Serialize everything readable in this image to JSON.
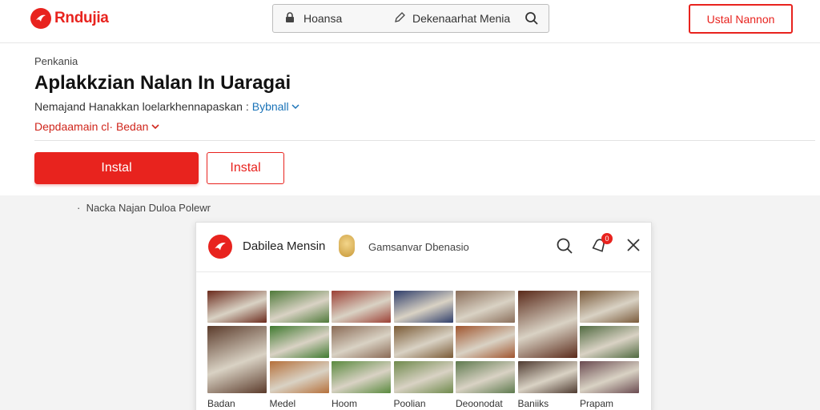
{
  "topbar": {
    "brand": "Rndujia",
    "search": {
      "left_label": "Hoansa",
      "placeholder": "Dekenaarhat Menia"
    },
    "install_button": "Ustal Nannon"
  },
  "main": {
    "breadcrumb": "Penkania",
    "title": "Aplakkzian Nalan In Uaragai",
    "meta_text": "Nemajand Hanakkan loelarkhennapaskan :",
    "meta_link": "Bybnall",
    "red_link": "Depdaamain cl· Bedan",
    "primary_button": "Instal",
    "secondary_button": "Instal"
  },
  "note": "Nacka Najan Duloa Polewr",
  "panel": {
    "title": "Dabilea Mensin",
    "subtitle": "Gamsanvar Dbenasio",
    "badge": "0",
    "gallery": [
      {
        "label": "Badan",
        "tiles": [
          {
            "color": "#6b2a1c",
            "size": "small"
          },
          {
            "color": "#5b3b2b",
            "size": "tall"
          }
        ]
      },
      {
        "label": "Medel",
        "tiles": [
          {
            "color": "#4f7a3a",
            "size": "small"
          },
          {
            "color": "#3f7a2f",
            "size": "small"
          },
          {
            "color": "#b5703a",
            "size": "small"
          }
        ]
      },
      {
        "label": "Hoom",
        "tiles": [
          {
            "color": "#9c4035",
            "size": "small"
          },
          {
            "color": "#8a6a55",
            "size": "small"
          },
          {
            "color": "#5a8a3e",
            "size": "small"
          }
        ]
      },
      {
        "label": "Poolian",
        "tiles": [
          {
            "color": "#2f3e6b",
            "size": "small"
          },
          {
            "color": "#7a5a35",
            "size": "small"
          },
          {
            "color": "#6f8a4c",
            "size": "small"
          }
        ]
      },
      {
        "label": "Deoonodat",
        "tiles": [
          {
            "color": "#8a6e5a",
            "size": "small"
          },
          {
            "color": "#a0552e",
            "size": "small"
          },
          {
            "color": "#5e7a4e",
            "size": "small"
          }
        ]
      },
      {
        "label": "Baniiks",
        "tiles": [
          {
            "color": "#5a2a1a",
            "size": "tall"
          },
          {
            "color": "#4e3a30",
            "size": "small"
          }
        ]
      },
      {
        "label": "Prapam",
        "tiles": [
          {
            "color": "#7a5a3a",
            "size": "small"
          },
          {
            "color": "#506a40",
            "size": "small"
          },
          {
            "color": "#6a4a50",
            "size": "small"
          }
        ]
      }
    ]
  },
  "colors": {
    "accent": "#e8231e",
    "link": "#1a73b8"
  }
}
